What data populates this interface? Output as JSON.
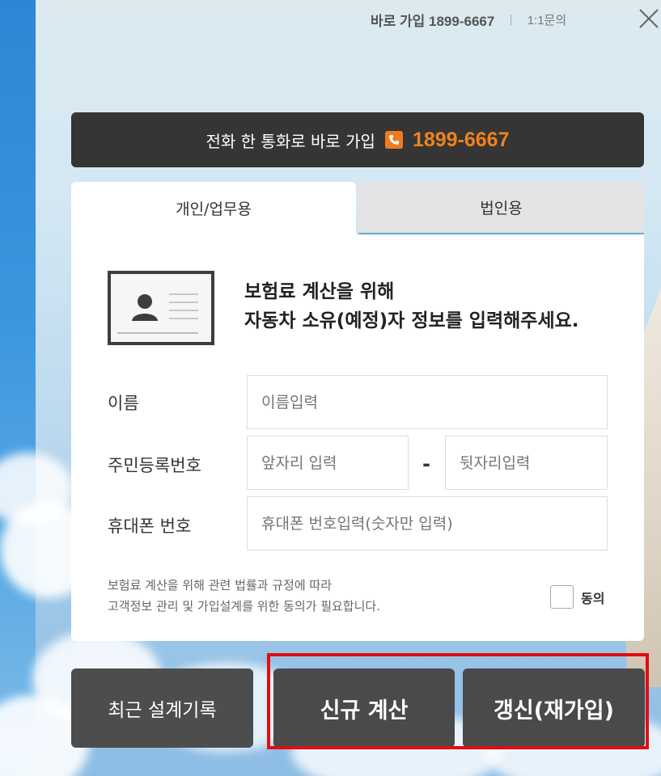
{
  "header": {
    "direct_join_label": "바로 가입 1899-6667",
    "separator": "|",
    "inquiry_label": "1:1문의"
  },
  "phone_banner": {
    "text": "전화 한 통화로 바로 가입",
    "number": "1899-6667"
  },
  "tabs": [
    {
      "label": "개인/업무용",
      "active": true
    },
    {
      "label": "법인용",
      "active": false
    }
  ],
  "form": {
    "intro_line1": "보험료 계산을 위해",
    "intro_line2": "자동차 소유(예정)자 정보를 입력해주세요.",
    "name_label": "이름",
    "name_placeholder": "이름입력",
    "rrn_label": "주민등록번호",
    "rrn_front_placeholder": "앞자리 입력",
    "rrn_separator": "-",
    "rrn_back_placeholder": "뒷자리입력",
    "phone_label": "휴대폰 번호",
    "phone_placeholder": "휴대폰 번호입력(숫자만 입력)",
    "notice_line1": "보험료 계산을 위해 관련 법률과 규정에 따라",
    "notice_line2": "고객정보 관리 및 가입설계를 위한 동의가 필요합니다.",
    "agree_label": "동의",
    "agree_checked": false
  },
  "buttons": {
    "history": "최근 설계기록",
    "new_quote": "신규 계산",
    "renew": "갱신(재가입)"
  },
  "colors": {
    "accent": "#f0821e",
    "dark": "#353535",
    "highlight": "#e00e14"
  },
  "icons": {
    "close": "close-icon",
    "phone": "phone-icon",
    "id_card": "id-card-icon"
  }
}
